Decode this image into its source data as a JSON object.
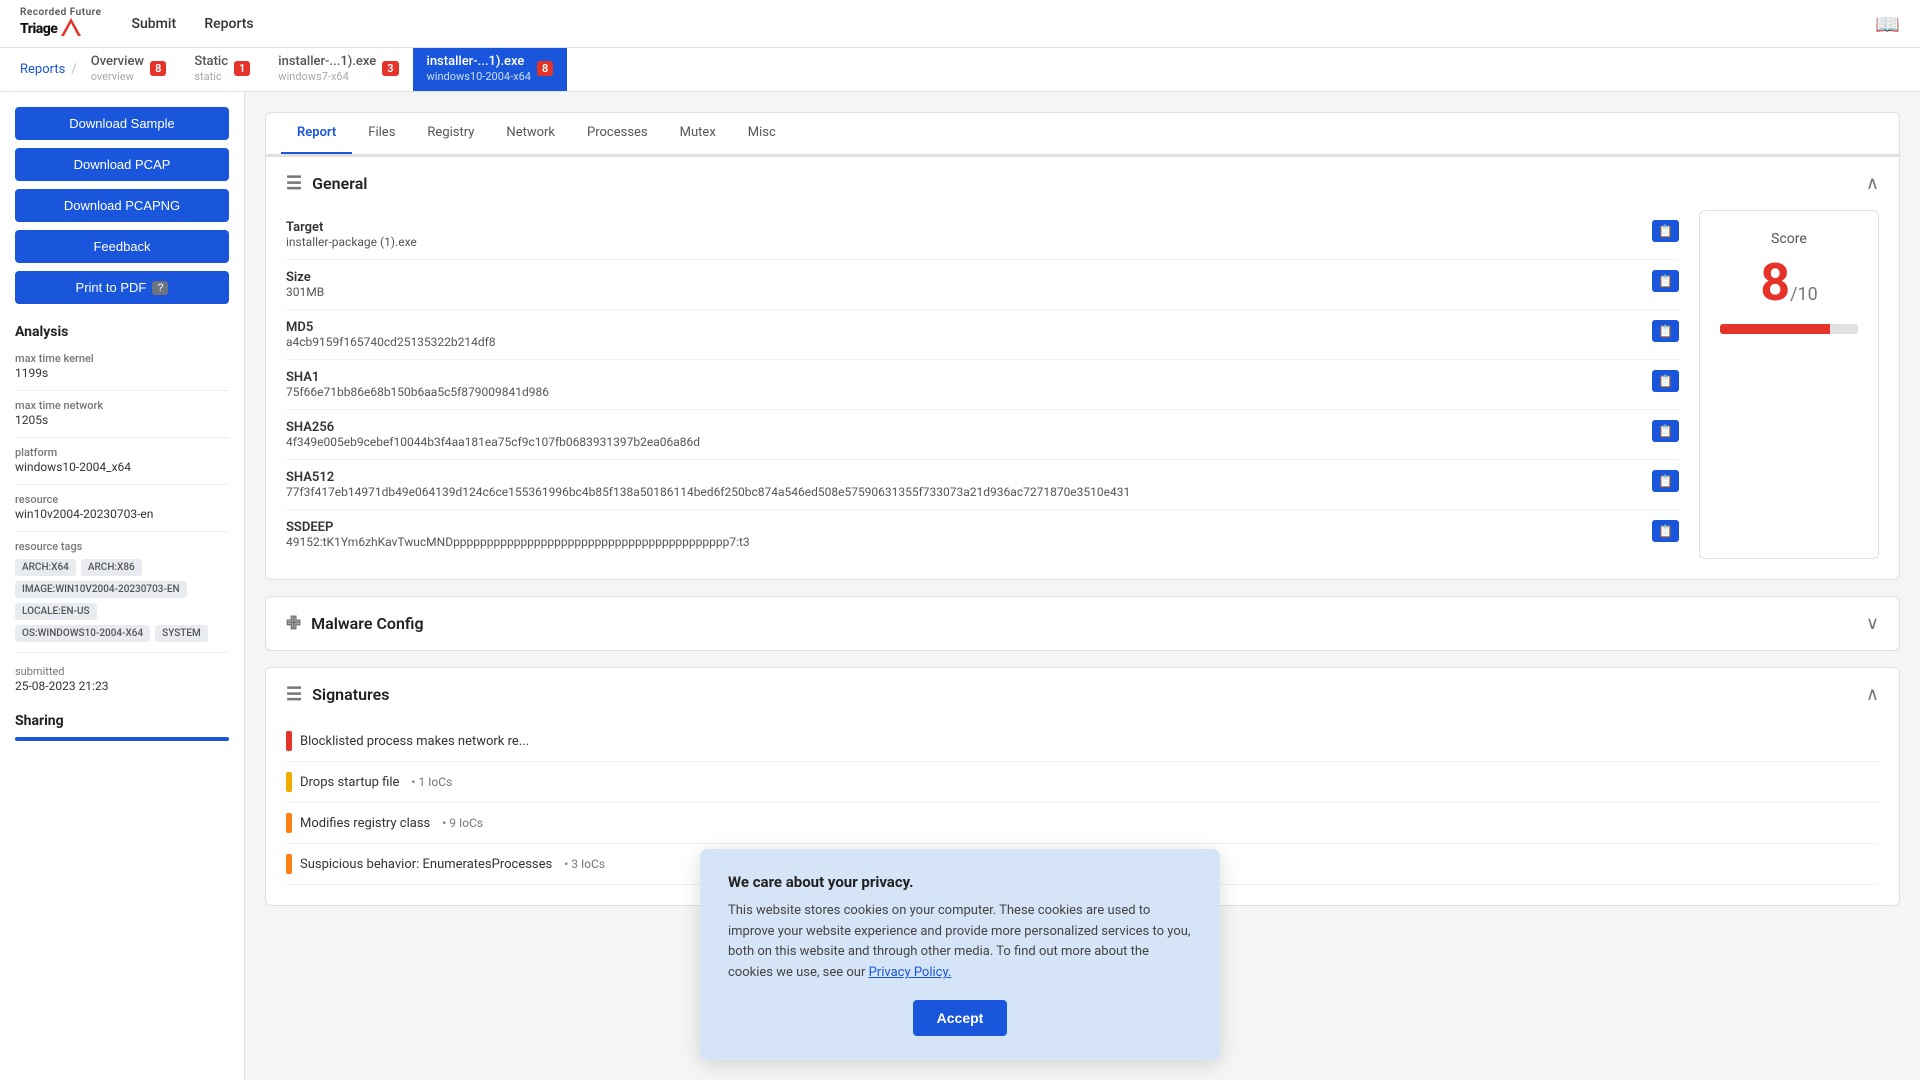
{
  "app": {
    "name": "Triage",
    "brand": "Recorded Future",
    "book_icon": "📖"
  },
  "nav": {
    "submit_label": "Submit",
    "reports_label": "Reports"
  },
  "breadcrumb": {
    "reports": "Reports",
    "separator": "/"
  },
  "tabs": [
    {
      "id": "overview",
      "label_main": "Overview",
      "label_sub": "overview",
      "badge": "8",
      "active": false
    },
    {
      "id": "static",
      "label_main": "Static",
      "label_sub": "static",
      "badge": "1",
      "active": false
    },
    {
      "id": "installer1",
      "label_main": "installer-...1).exe",
      "label_sub": "windows7-x64",
      "badge": "3",
      "active": false
    },
    {
      "id": "installer2",
      "label_main": "installer-...1).exe",
      "label_sub": "windows10-2004-x64",
      "badge": "8",
      "active": true
    }
  ],
  "sidebar": {
    "download_sample": "Download Sample",
    "download_pcap": "Download PCAP",
    "download_pcapng": "Download PCAPNG",
    "feedback": "Feedback",
    "print_to_pdf": "Print to PDF",
    "help_badge": "?",
    "analysis_title": "Analysis",
    "max_time_kernel_label": "max time kernel",
    "max_time_kernel_value": "1199s",
    "max_time_network_label": "max time network",
    "max_time_network_value": "1205s",
    "platform_label": "platform",
    "platform_value": "windows10-2004_x64",
    "resource_label": "resource",
    "resource_value": "win10v2004-20230703-en",
    "resource_tags_label": "resource tags",
    "tags": [
      "ARCH:X64",
      "ARCH:X86",
      "IMAGE:WIN10V2004-20230703-EN",
      "LOCALE:EN-US",
      "OS:WINDOWS10-2004-X64",
      "SYSTEM"
    ],
    "submitted_label": "submitted",
    "submitted_value": "25-08-2023 21:23",
    "sharing_title": "Sharing"
  },
  "content_tabs": [
    {
      "id": "report",
      "label": "Report",
      "active": true
    },
    {
      "id": "files",
      "label": "Files",
      "active": false
    },
    {
      "id": "registry",
      "label": "Registry",
      "active": false
    },
    {
      "id": "network",
      "label": "Network",
      "active": false
    },
    {
      "id": "processes",
      "label": "Processes",
      "active": false
    },
    {
      "id": "mutex",
      "label": "Mutex",
      "active": false
    },
    {
      "id": "misc",
      "label": "Misc",
      "active": false
    }
  ],
  "general": {
    "title": "General",
    "fields": [
      {
        "label": "Target",
        "value": "installer-package (1).exe"
      },
      {
        "label": "Size",
        "value": "301MB"
      },
      {
        "label": "MD5",
        "value": "a4cb9159f165740cd25135322b214df8"
      },
      {
        "label": "SHA1",
        "value": "75f66e71bb86e68b150b6aa5c5f879009841d986"
      },
      {
        "label": "SHA256",
        "value": "4f349e005eb9cebef10044b3f4aa181ea75cf9c107fb0683931397b2ea06a86d"
      },
      {
        "label": "SHA512",
        "value": "77f3f417eb14971db49e064139d124c6ce155361996bc4b85f138a50186114bed6f250bc874a546ed508e57590631355f733073a21d936ac7271870e3510e431"
      },
      {
        "label": "SSDEEP",
        "value": "49152:tK1Ym6zhKavTwucMNDppppppppppppppppppppppppppppppppppppppppp7:t3"
      }
    ],
    "score": {
      "title": "Score",
      "value": "8",
      "max": "/10",
      "bar_percent": 80
    }
  },
  "malware_config": {
    "title": "Malware Config",
    "collapsed": true
  },
  "signatures": {
    "title": "Signatures",
    "items": [
      {
        "text": "Blocklisted process makes network re...",
        "severity": "red",
        "ioc": null
      },
      {
        "text": "Drops startup file",
        "severity": "yellow",
        "ioc": "• 1 IoCs"
      },
      {
        "text": "Modifies registry class",
        "severity": "orange",
        "ioc": "• 9 IoCs"
      },
      {
        "text": "Suspicious behavior: EnumeratesProcesses",
        "severity": "orange",
        "ioc": "• 3 IoCs"
      }
    ]
  },
  "cookie": {
    "title": "We care about your privacy.",
    "text": "This website stores cookies on your computer. These cookies are used to improve your website experience and provide more personalized services to you, both on this website and through other media. To find out more about the cookies we use, see our ",
    "link_text": "Privacy Policy.",
    "accept_label": "Accept"
  }
}
